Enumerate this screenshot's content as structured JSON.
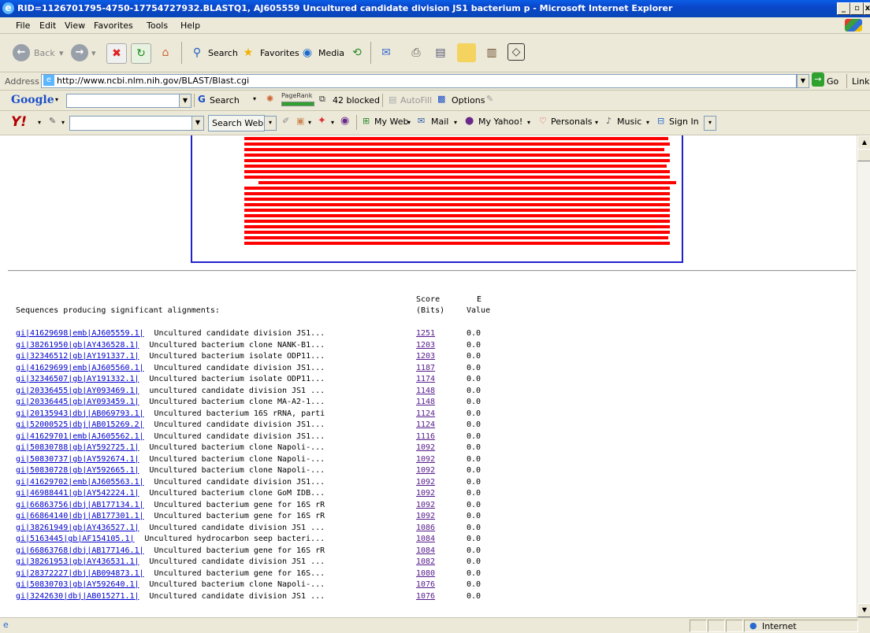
{
  "window": {
    "title": "RID=1126701795-4750-17754727932.BLASTQ1, AJ605559 Uncultured candidate division JS1 bacterium p - Microsoft Internet Explorer",
    "controls": [
      "_",
      "▫",
      "x"
    ]
  },
  "menu": [
    "File",
    "Edit",
    "View",
    "Favorites",
    "Tools",
    "Help"
  ],
  "toolbar": {
    "back": "Back",
    "search": "Search",
    "favorites": "Favorites",
    "media": "Media"
  },
  "address": {
    "label": "Address",
    "url": "http://www.ncbi.nlm.nih.gov/BLAST/Blast.cgi",
    "go": "Go",
    "links": "Links"
  },
  "googlebar": {
    "logo": "Google",
    "search": "Search",
    "pagerank": "PageRank",
    "blocked": "42 blocked",
    "autofill": "AutoFill",
    "options": "Options"
  },
  "yahoobar": {
    "logo": "Y!",
    "search_web": "Search Web",
    "my_web": "My Web",
    "mail": "Mail",
    "my_yahoo": "My Yahoo!",
    "personals": "Personals",
    "music": "Music",
    "sign_in": "Sign In"
  },
  "results": {
    "header_left": "Sequences producing significant alignments:",
    "col_score_1": "Score",
    "col_score_2": "(Bits)",
    "col_e_1": "E",
    "col_e_2": "Value",
    "rows": [
      {
        "id": "gi|41629698|emb|AJ605559.1|",
        "desc": "Uncultured candidate division JS1...",
        "score": "1251",
        "evalue": "0.0"
      },
      {
        "id": "gi|38261950|gb|AY436528.1|",
        "desc": "Uncultured bacterium clone NANK-B1...",
        "score": "1203",
        "evalue": "0.0"
      },
      {
        "id": "gi|32346512|gb|AY191337.1|",
        "desc": "Uncultured bacterium isolate ODP11...",
        "score": "1203",
        "evalue": "0.0"
      },
      {
        "id": "gi|41629699|emb|AJ605560.1|",
        "desc": "Uncultured candidate division JS1...",
        "score": "1187",
        "evalue": "0.0"
      },
      {
        "id": "gi|32346507|gb|AY191332.1|",
        "desc": "Uncultured bacterium isolate ODP11...",
        "score": "1174",
        "evalue": "0.0"
      },
      {
        "id": "gi|20336455|gb|AY093469.1|",
        "desc": "uncultured candidate division JS1 ...",
        "score": "1148",
        "evalue": "0.0"
      },
      {
        "id": "gi|20336445|gb|AY093459.1|",
        "desc": "Uncultured bacterium clone MA-A2-1...",
        "score": "1148",
        "evalue": "0.0"
      },
      {
        "id": "gi|20135943|dbj|AB069793.1|",
        "desc": "Uncultured bacterium 16S rRNA, parti",
        "score": "1124",
        "evalue": "0.0"
      },
      {
        "id": "gi|52000525|dbj|AB015269.2|",
        "desc": "Uncultured candidate division JS1...",
        "score": "1124",
        "evalue": "0.0"
      },
      {
        "id": "gi|41629701|emb|AJ605562.1|",
        "desc": "Uncultured candidate division JS1...",
        "score": "1116",
        "evalue": "0.0"
      },
      {
        "id": "gi|50830788|gb|AY592725.1|",
        "desc": "Uncultured bacterium clone Napoli-...",
        "score": "1092",
        "evalue": "0.0"
      },
      {
        "id": "gi|50830737|gb|AY592674.1|",
        "desc": "Uncultured bacterium clone Napoli-...",
        "score": "1092",
        "evalue": "0.0"
      },
      {
        "id": "gi|50830728|gb|AY592665.1|",
        "desc": "Uncultured bacterium clone Napoli-...",
        "score": "1092",
        "evalue": "0.0"
      },
      {
        "id": "gi|41629702|emb|AJ605563.1|",
        "desc": "Uncultured candidate division JS1...",
        "score": "1092",
        "evalue": "0.0"
      },
      {
        "id": "gi|46988441|gb|AY542224.1|",
        "desc": "Uncultured bacterium clone GoM IDB...",
        "score": "1092",
        "evalue": "0.0"
      },
      {
        "id": "gi|66863756|dbj|AB177134.1|",
        "desc": "Uncultured bacterium gene for 16S rR",
        "score": "1092",
        "evalue": "0.0"
      },
      {
        "id": "gi|66864140|dbj|AB177301.1|",
        "desc": "Uncultured bacterium gene for 16S rR",
        "score": "1092",
        "evalue": "0.0"
      },
      {
        "id": "gi|38261949|gb|AY436527.1|",
        "desc": "Uncultured candidate division JS1 ...",
        "score": "1086",
        "evalue": "0.0"
      },
      {
        "id": "gi|5163445|gb|AF154105.1|",
        "desc": "Uncultured hydrocarbon seep bacteri...",
        "score": "1084",
        "evalue": "0.0"
      },
      {
        "id": "gi|66863768|dbj|AB177146.1|",
        "desc": "Uncultured bacterium gene for 16S rR",
        "score": "1084",
        "evalue": "0.0"
      },
      {
        "id": "gi|38261953|gb|AY436531.1|",
        "desc": "Uncultured candidate division JS1 ...",
        "score": "1082",
        "evalue": "0.0"
      },
      {
        "id": "gi|28372227|dbj|AB094873.1|",
        "desc": "Uncultured bacterium gene for 16S...",
        "score": "1080",
        "evalue": "0.0"
      },
      {
        "id": "gi|50830703|gb|AY592640.1|",
        "desc": "Uncultured bacterium clone Napoli-...",
        "score": "1076",
        "evalue": "0.0"
      },
      {
        "id": "gi|3242630|dbj|AB015271.1|",
        "desc": "Uncultured candidate division JS1 ...",
        "score": "1076",
        "evalue": "0.0"
      }
    ]
  },
  "status": {
    "zone": "Internet"
  },
  "colors": {
    "hit_bar": "#ff0000",
    "graphic_border": "#2222cc",
    "link": "#0000cc",
    "visited": "#551a8b"
  }
}
